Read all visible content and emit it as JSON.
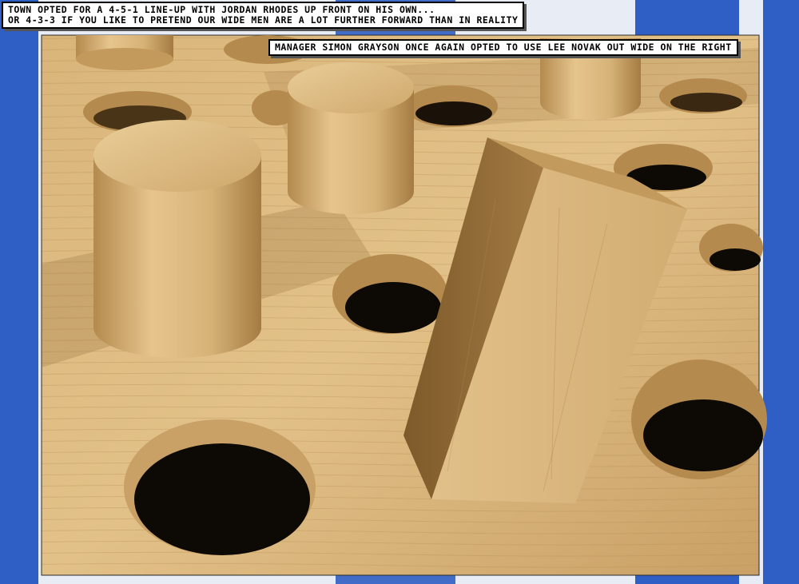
{
  "captions": {
    "top_left": {
      "line1": "Town opted for a 4-5-1 line-up with Jordan Rhodes up front on his own...",
      "line2": "or 4-3-3 if you like to pretend our wide men are a lot further forward than in reality"
    },
    "top_right": {
      "line1": "Manager Simon Grayson once again opted to use Lee Novak out wide on the right"
    }
  },
  "colors": {
    "frame_blue": "#2f5fc4",
    "frame_white": "#e8ecf5",
    "wood_light": "#e2c188",
    "wood_mid": "#c89e5e",
    "wood_dark": "#8c6633",
    "hole": "#0d0a05"
  }
}
